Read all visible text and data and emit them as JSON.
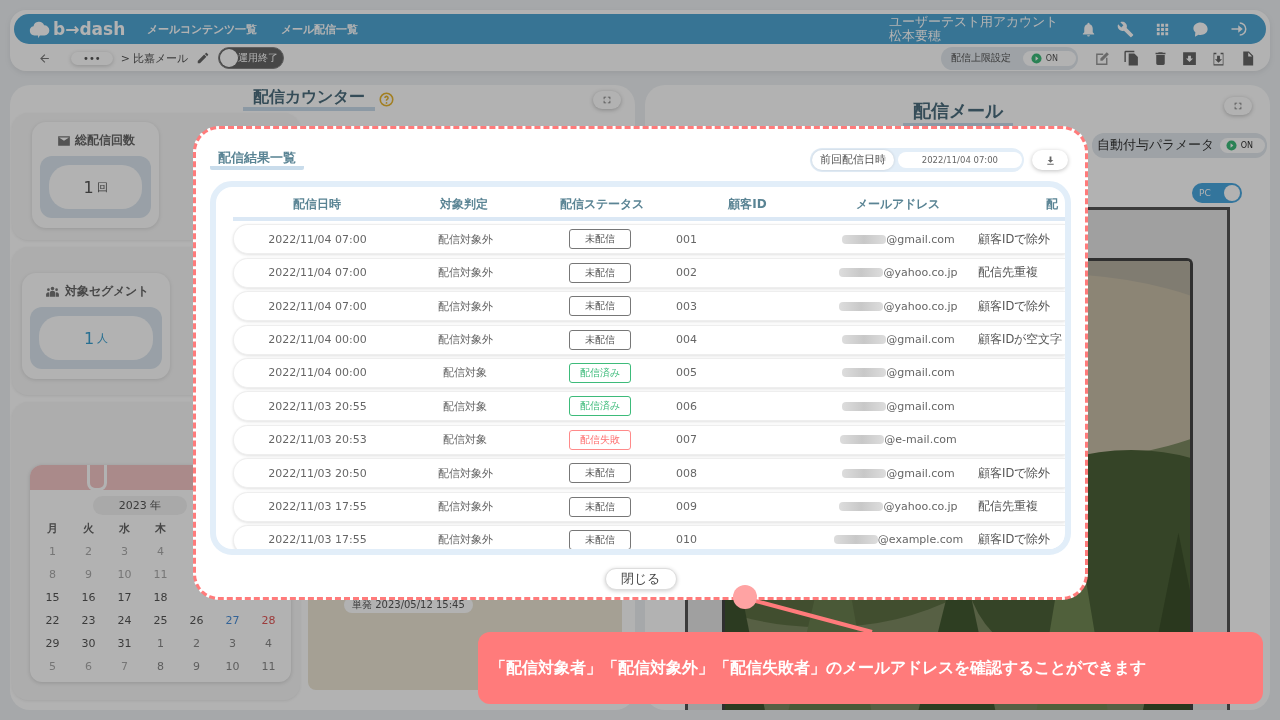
{
  "header": {
    "logo": "b→dash",
    "nav": [
      {
        "label": "メールコンテンツ一覧"
      },
      {
        "label": "メール配信一覧"
      }
    ],
    "account": {
      "org": "ユーザーテスト用アカウント",
      "user": "松本要穂"
    }
  },
  "toolbar": {
    "more": "•••",
    "breadcrumb": "> 比嘉メール",
    "status_toggle": {
      "label": "運用終了",
      "on": false
    },
    "limit": {
      "label": "配信上限設定",
      "value": "ON",
      "on": true
    }
  },
  "counter_panel": {
    "title": "配信カウンター",
    "total": {
      "label": "総配信回数",
      "value": "1",
      "unit": "回"
    },
    "segment": {
      "label": "対象セグメント",
      "value": "1",
      "unit": "人"
    },
    "calendar": {
      "year": "2023 年",
      "weekdays": [
        "月",
        "火",
        "水",
        "木"
      ],
      "weeks": [
        [
          {
            "day": "1",
            "kind": "disabled"
          },
          {
            "day": "2",
            "kind": "disabled"
          },
          {
            "day": "3",
            "kind": "disabled"
          },
          {
            "day": "4",
            "kind": "disabled"
          }
        ],
        [
          {
            "day": "8",
            "kind": "disabled"
          },
          {
            "day": "9",
            "kind": "disabled"
          },
          {
            "day": "10",
            "kind": "disabled"
          },
          {
            "day": "11",
            "kind": "disabled"
          }
        ],
        [
          {
            "day": "15",
            "kind": "normal"
          },
          {
            "day": "16",
            "kind": "normal"
          },
          {
            "day": "17",
            "kind": "normal"
          },
          {
            "day": "18",
            "kind": "normal"
          }
        ],
        [
          {
            "day": "22",
            "kind": "normal"
          },
          {
            "day": "23",
            "kind": "normal"
          },
          {
            "day": "24",
            "kind": "normal"
          },
          {
            "day": "25",
            "kind": "normal"
          },
          {
            "day": "26",
            "kind": "normal"
          },
          {
            "day": "27",
            "kind": "saturday"
          },
          {
            "day": "28",
            "kind": "sunday"
          }
        ],
        [
          {
            "day": "29",
            "kind": "normal"
          },
          {
            "day": "30",
            "kind": "normal"
          },
          {
            "day": "31",
            "kind": "normal"
          },
          {
            "day": "1",
            "kind": "other"
          },
          {
            "day": "2",
            "kind": "other"
          },
          {
            "day": "3",
            "kind": "other"
          },
          {
            "day": "4",
            "kind": "other"
          }
        ],
        [
          {
            "day": "5",
            "kind": "disabled"
          },
          {
            "day": "6",
            "kind": "disabled"
          },
          {
            "day": "7",
            "kind": "disabled"
          },
          {
            "day": "8",
            "kind": "other"
          },
          {
            "day": "9",
            "kind": "other"
          },
          {
            "day": "10",
            "kind": "other"
          },
          {
            "day": "11",
            "kind": "other"
          }
        ]
      ]
    },
    "schedule": "単発 2023/05/12 15:45"
  },
  "mail_panel": {
    "title": "配信メール",
    "param": {
      "label": "自動付与パラメータ",
      "value": "ON",
      "on": true
    },
    "device_toggle": {
      "label": "PC",
      "on": true
    }
  },
  "result_modal": {
    "title": "配信結果一覧",
    "last_sent": {
      "label": "前回配信日時",
      "value": "2022/11/04 07:00"
    },
    "columns": [
      "配信日時",
      "対象判定",
      "配信ステータス",
      "顧客ID",
      "メールアドレス",
      "配"
    ],
    "rows": [
      {
        "date": "2022/11/04 07:00",
        "target": "配信対象外",
        "status": {
          "label": "未配信",
          "kind": "pending"
        },
        "id": "001",
        "email": "@gmail.com",
        "reason": "顧客IDで除外"
      },
      {
        "date": "2022/11/04 07:00",
        "target": "配信対象外",
        "status": {
          "label": "未配信",
          "kind": "pending"
        },
        "id": "002",
        "email": "@yahoo.co.jp",
        "reason": "配信先重複"
      },
      {
        "date": "2022/11/04 07:00",
        "target": "配信対象外",
        "status": {
          "label": "未配信",
          "kind": "pending"
        },
        "id": "003",
        "email": "@yahoo.co.jp",
        "reason": "顧客IDで除外"
      },
      {
        "date": "2022/11/04 00:00",
        "target": "配信対象外",
        "status": {
          "label": "未配信",
          "kind": "pending"
        },
        "id": "004",
        "email": "@gmail.com",
        "reason": "顧客IDが空文字"
      },
      {
        "date": "2022/11/04 00:00",
        "target": "配信対象",
        "status": {
          "label": "配信済み",
          "kind": "sent"
        },
        "id": "005",
        "email": "@gmail.com"
      },
      {
        "date": "2022/11/03 20:55",
        "target": "配信対象",
        "status": {
          "label": "配信済み",
          "kind": "sent"
        },
        "id": "006",
        "email": "@gmail.com"
      },
      {
        "date": "2022/11/03 20:53",
        "target": "配信対象",
        "status": {
          "label": "配信失敗",
          "kind": "failed"
        },
        "id": "007",
        "email": "@e-mail.com"
      },
      {
        "date": "2022/11/03 20:50",
        "target": "配信対象外",
        "status": {
          "label": "未配信",
          "kind": "pending"
        },
        "id": "008",
        "email": "@gmail.com",
        "reason": "顧客IDで除外"
      },
      {
        "date": "2022/11/03 17:55",
        "target": "配信対象外",
        "status": {
          "label": "未配信",
          "kind": "pending"
        },
        "id": "009",
        "email": "@yahoo.co.jp",
        "reason": "配信先重複"
      },
      {
        "date": "2022/11/03 17:55",
        "target": "配信対象外",
        "status": {
          "label": "未配信",
          "kind": "pending"
        },
        "id": "010",
        "email": "@example.com",
        "reason": "顧客IDで除外"
      }
    ],
    "close": "閉じる"
  },
  "callout": {
    "text": "「配信対象者」「配信対象外」「配信失敗者」のメールアドレスを確認することができます"
  }
}
